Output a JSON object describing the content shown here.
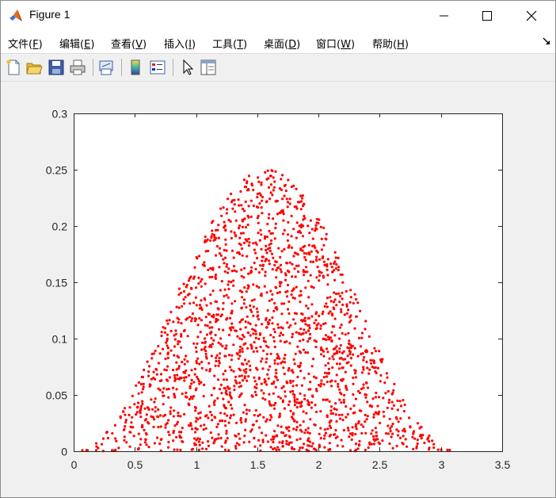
{
  "window": {
    "title": "Figure 1",
    "controls": {
      "minimize": "minimize",
      "maximize": "maximize",
      "close": "close"
    }
  },
  "menu": [
    {
      "label": "文件",
      "key": "F"
    },
    {
      "label": "编辑",
      "key": "E"
    },
    {
      "label": "查看",
      "key": "V"
    },
    {
      "label": "插入",
      "key": "I"
    },
    {
      "label": "工具",
      "key": "T"
    },
    {
      "label": "桌面",
      "key": "D"
    },
    {
      "label": "窗口",
      "key": "W"
    },
    {
      "label": "帮助",
      "key": "H"
    }
  ],
  "toolbar": [
    "new-figure-icon",
    "open-file-icon",
    "save-icon",
    "print-icon",
    "link-plot-icon",
    "insert-colorbar-icon",
    "insert-legend-icon",
    "edit-plot-arrow-icon",
    "property-inspector-icon"
  ],
  "chart_data": {
    "type": "scatter",
    "title": "",
    "xlabel": "",
    "ylabel": "",
    "xlim": [
      0,
      3.5
    ],
    "ylim": [
      0,
      0.3
    ],
    "xticks": [
      "0",
      "0.5",
      "1",
      "1.5",
      "2",
      "2.5",
      "3",
      "3.5"
    ],
    "yticks": [
      "0",
      "0.05",
      "0.1",
      "0.15",
      "0.2",
      "0.25",
      "0.3"
    ],
    "grid": false,
    "marker_color": "#ff0000",
    "series": [
      {
        "description": "random points uniformly filling the region under y = sin(x)^2/4 for x in [0, pi]",
        "count": 2000,
        "envelope": "sin(x)^2/4",
        "x_range": [
          0,
          3.1416
        ],
        "y_range": [
          0,
          0.25
        ]
      }
    ]
  }
}
